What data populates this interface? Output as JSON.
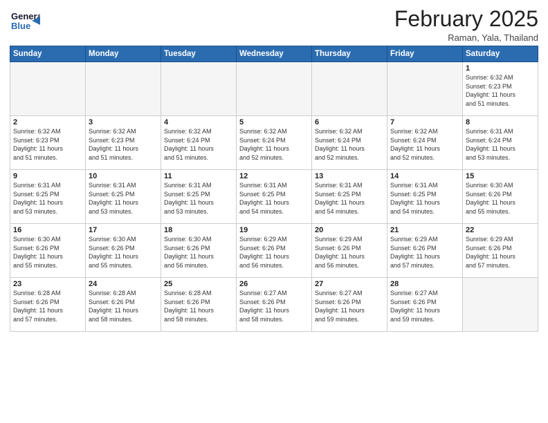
{
  "header": {
    "logo_line1": "General",
    "logo_line2": "Blue",
    "title": "February 2025",
    "subtitle": "Raman, Yala, Thailand"
  },
  "weekdays": [
    "Sunday",
    "Monday",
    "Tuesday",
    "Wednesday",
    "Thursday",
    "Friday",
    "Saturday"
  ],
  "weeks": [
    [
      {
        "day": "",
        "info": ""
      },
      {
        "day": "",
        "info": ""
      },
      {
        "day": "",
        "info": ""
      },
      {
        "day": "",
        "info": ""
      },
      {
        "day": "",
        "info": ""
      },
      {
        "day": "",
        "info": ""
      },
      {
        "day": "1",
        "info": "Sunrise: 6:32 AM\nSunset: 6:23 PM\nDaylight: 11 hours\nand 51 minutes."
      }
    ],
    [
      {
        "day": "2",
        "info": "Sunrise: 6:32 AM\nSunset: 6:23 PM\nDaylight: 11 hours\nand 51 minutes."
      },
      {
        "day": "3",
        "info": "Sunrise: 6:32 AM\nSunset: 6:23 PM\nDaylight: 11 hours\nand 51 minutes."
      },
      {
        "day": "4",
        "info": "Sunrise: 6:32 AM\nSunset: 6:24 PM\nDaylight: 11 hours\nand 51 minutes."
      },
      {
        "day": "5",
        "info": "Sunrise: 6:32 AM\nSunset: 6:24 PM\nDaylight: 11 hours\nand 52 minutes."
      },
      {
        "day": "6",
        "info": "Sunrise: 6:32 AM\nSunset: 6:24 PM\nDaylight: 11 hours\nand 52 minutes."
      },
      {
        "day": "7",
        "info": "Sunrise: 6:32 AM\nSunset: 6:24 PM\nDaylight: 11 hours\nand 52 minutes."
      },
      {
        "day": "8",
        "info": "Sunrise: 6:31 AM\nSunset: 6:24 PM\nDaylight: 11 hours\nand 53 minutes."
      }
    ],
    [
      {
        "day": "9",
        "info": "Sunrise: 6:31 AM\nSunset: 6:25 PM\nDaylight: 11 hours\nand 53 minutes."
      },
      {
        "day": "10",
        "info": "Sunrise: 6:31 AM\nSunset: 6:25 PM\nDaylight: 11 hours\nand 53 minutes."
      },
      {
        "day": "11",
        "info": "Sunrise: 6:31 AM\nSunset: 6:25 PM\nDaylight: 11 hours\nand 53 minutes."
      },
      {
        "day": "12",
        "info": "Sunrise: 6:31 AM\nSunset: 6:25 PM\nDaylight: 11 hours\nand 54 minutes."
      },
      {
        "day": "13",
        "info": "Sunrise: 6:31 AM\nSunset: 6:25 PM\nDaylight: 11 hours\nand 54 minutes."
      },
      {
        "day": "14",
        "info": "Sunrise: 6:31 AM\nSunset: 6:25 PM\nDaylight: 11 hours\nand 54 minutes."
      },
      {
        "day": "15",
        "info": "Sunrise: 6:30 AM\nSunset: 6:26 PM\nDaylight: 11 hours\nand 55 minutes."
      }
    ],
    [
      {
        "day": "16",
        "info": "Sunrise: 6:30 AM\nSunset: 6:26 PM\nDaylight: 11 hours\nand 55 minutes."
      },
      {
        "day": "17",
        "info": "Sunrise: 6:30 AM\nSunset: 6:26 PM\nDaylight: 11 hours\nand 55 minutes."
      },
      {
        "day": "18",
        "info": "Sunrise: 6:30 AM\nSunset: 6:26 PM\nDaylight: 11 hours\nand 56 minutes."
      },
      {
        "day": "19",
        "info": "Sunrise: 6:29 AM\nSunset: 6:26 PM\nDaylight: 11 hours\nand 56 minutes."
      },
      {
        "day": "20",
        "info": "Sunrise: 6:29 AM\nSunset: 6:26 PM\nDaylight: 11 hours\nand 56 minutes."
      },
      {
        "day": "21",
        "info": "Sunrise: 6:29 AM\nSunset: 6:26 PM\nDaylight: 11 hours\nand 57 minutes."
      },
      {
        "day": "22",
        "info": "Sunrise: 6:29 AM\nSunset: 6:26 PM\nDaylight: 11 hours\nand 57 minutes."
      }
    ],
    [
      {
        "day": "23",
        "info": "Sunrise: 6:28 AM\nSunset: 6:26 PM\nDaylight: 11 hours\nand 57 minutes."
      },
      {
        "day": "24",
        "info": "Sunrise: 6:28 AM\nSunset: 6:26 PM\nDaylight: 11 hours\nand 58 minutes."
      },
      {
        "day": "25",
        "info": "Sunrise: 6:28 AM\nSunset: 6:26 PM\nDaylight: 11 hours\nand 58 minutes."
      },
      {
        "day": "26",
        "info": "Sunrise: 6:27 AM\nSunset: 6:26 PM\nDaylight: 11 hours\nand 58 minutes."
      },
      {
        "day": "27",
        "info": "Sunrise: 6:27 AM\nSunset: 6:26 PM\nDaylight: 11 hours\nand 59 minutes."
      },
      {
        "day": "28",
        "info": "Sunrise: 6:27 AM\nSunset: 6:26 PM\nDaylight: 11 hours\nand 59 minutes."
      },
      {
        "day": "",
        "info": ""
      }
    ]
  ]
}
